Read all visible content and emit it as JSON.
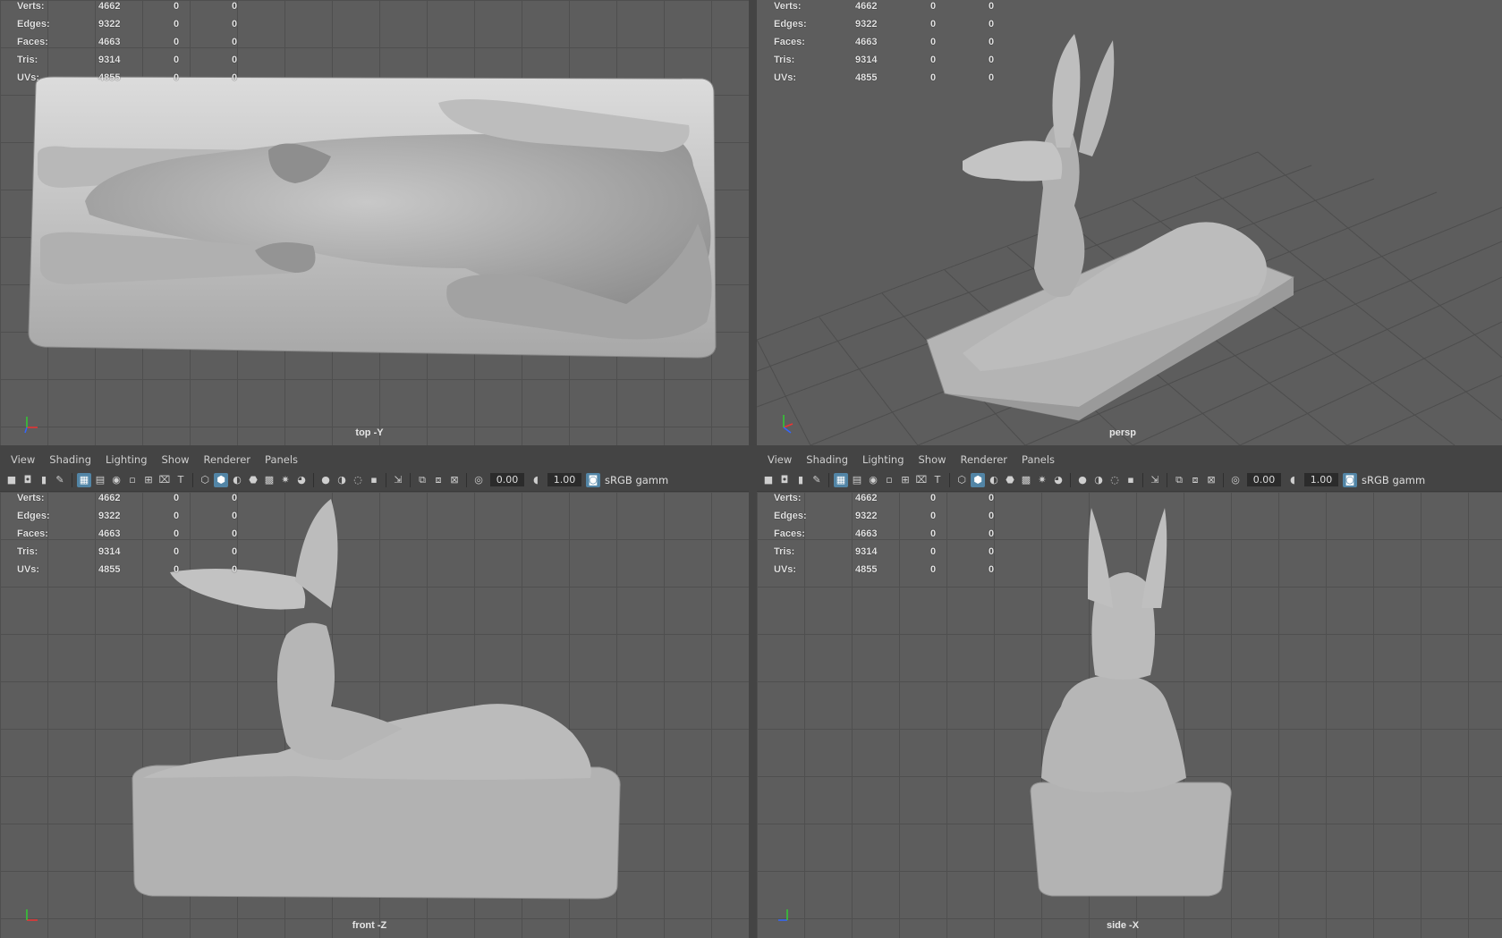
{
  "menu": [
    "View",
    "Shading",
    "Lighting",
    "Show",
    "Renderer",
    "Panels"
  ],
  "toolbar": {
    "exposure": "0.00",
    "gamma": "1.00",
    "color_space": "sRGB gamm"
  },
  "stats_labels": [
    "Verts:",
    "Edges:",
    "Faces:",
    "Tris:",
    "UVs:"
  ],
  "stats": {
    "verts": [
      "4662",
      "0",
      "0"
    ],
    "edges": [
      "9322",
      "0",
      "0"
    ],
    "faces": [
      "4663",
      "0",
      "0"
    ],
    "tris": [
      "9314",
      "0",
      "0"
    ],
    "uvs": [
      "4855",
      "0",
      "0"
    ]
  },
  "panels": {
    "top": {
      "camera": "top -Y"
    },
    "persp": {
      "camera": "persp"
    },
    "front": {
      "camera": "front -Z"
    },
    "side": {
      "camera": "side -X"
    }
  },
  "icons": [
    "camera-icon",
    "camera-attr-icon",
    "bookmark-icon",
    "image-plane-icon",
    "grid-icon",
    "wireframe-icon",
    "smooth-shade-icon",
    "textured-icon",
    "lights-icon",
    "shadows-icon",
    "isolate-icon",
    "xray-icon",
    "exposure-icon",
    "gamma-icon",
    "color-management-icon"
  ],
  "colors": {
    "viewport_bg": "#5d5d5d",
    "grid": "#4f4f4f",
    "active_icon": "#5285a6",
    "model": "#b4b4b4"
  }
}
